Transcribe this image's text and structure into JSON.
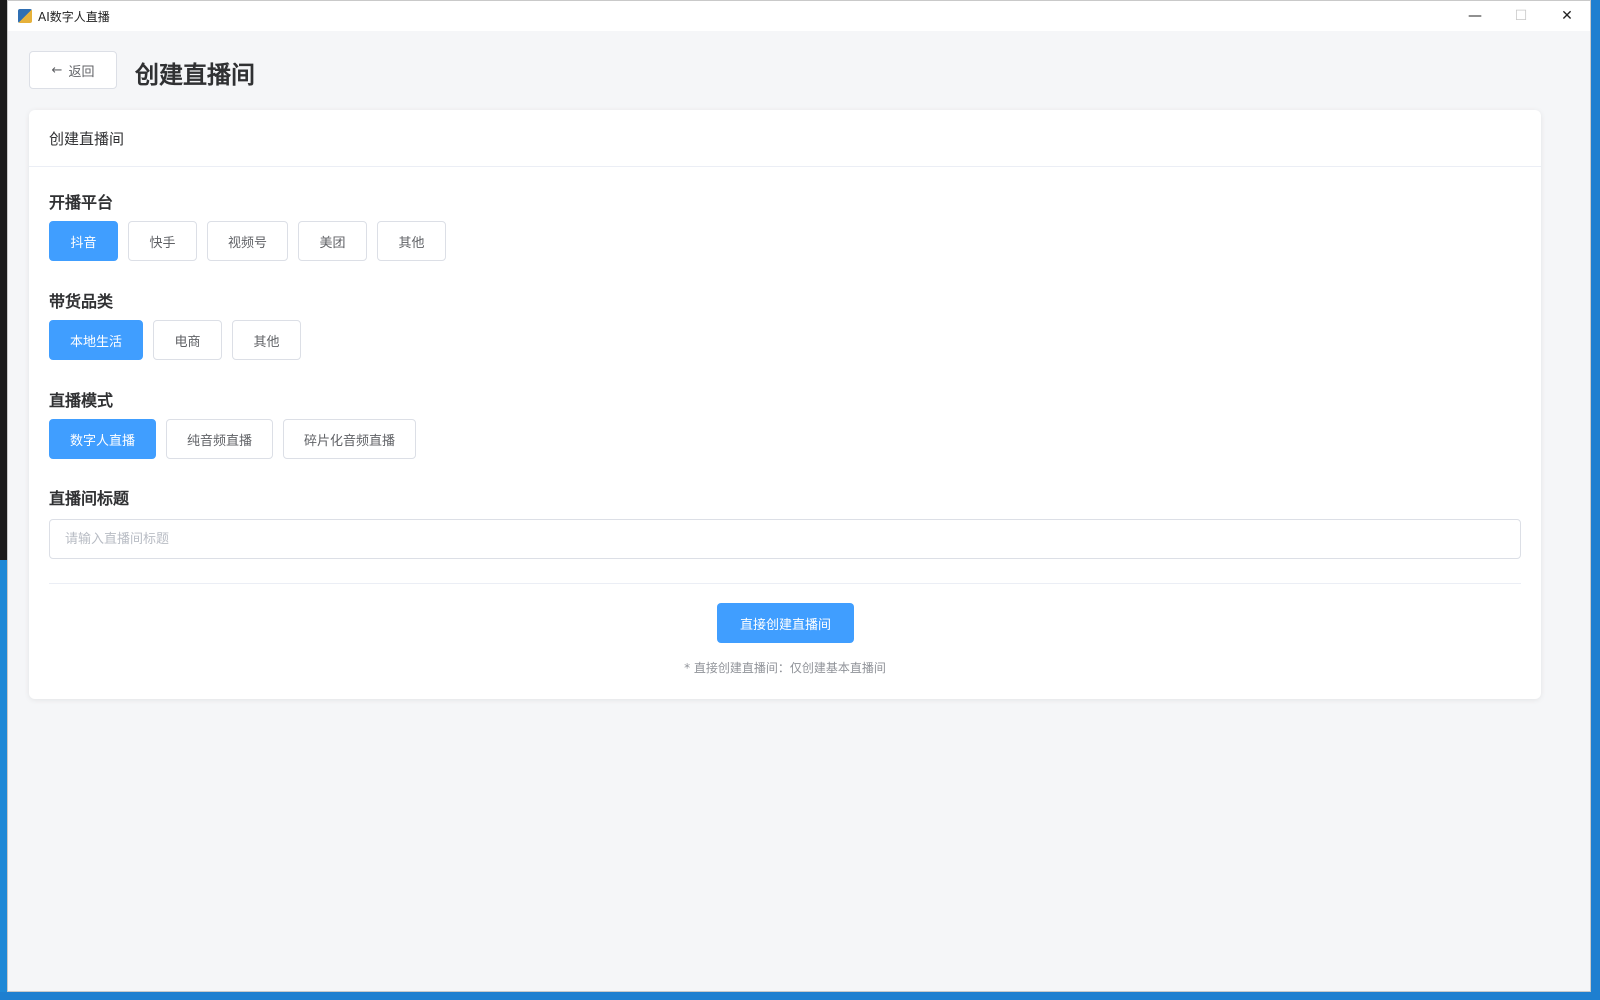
{
  "window": {
    "title": "AI数字人直播",
    "minimize": "—",
    "maximize": "☐",
    "close": "✕"
  },
  "header": {
    "back_label": "返回",
    "page_title": "创建直播间"
  },
  "card": {
    "title": "创建直播间"
  },
  "platform": {
    "label": "开播平台",
    "options": [
      "抖音",
      "快手",
      "视频号",
      "美团",
      "其他"
    ],
    "selected": "抖音"
  },
  "category": {
    "label": "带货品类",
    "options": [
      "本地生活",
      "电商",
      "其他"
    ],
    "selected": "本地生活"
  },
  "mode": {
    "label": "直播模式",
    "options": [
      "数字人直播",
      "纯音频直播",
      "碎片化音频直播"
    ],
    "selected": "数字人直播"
  },
  "room_title": {
    "label": "直播间标题",
    "value": "",
    "placeholder": "请输入直播间标题"
  },
  "actions": {
    "create_label": "直接创建直播间",
    "hint": "* 直接创建直播间：仅创建基本直播间"
  },
  "colors": {
    "primary": "#409eff",
    "background": "#f5f6f8"
  }
}
